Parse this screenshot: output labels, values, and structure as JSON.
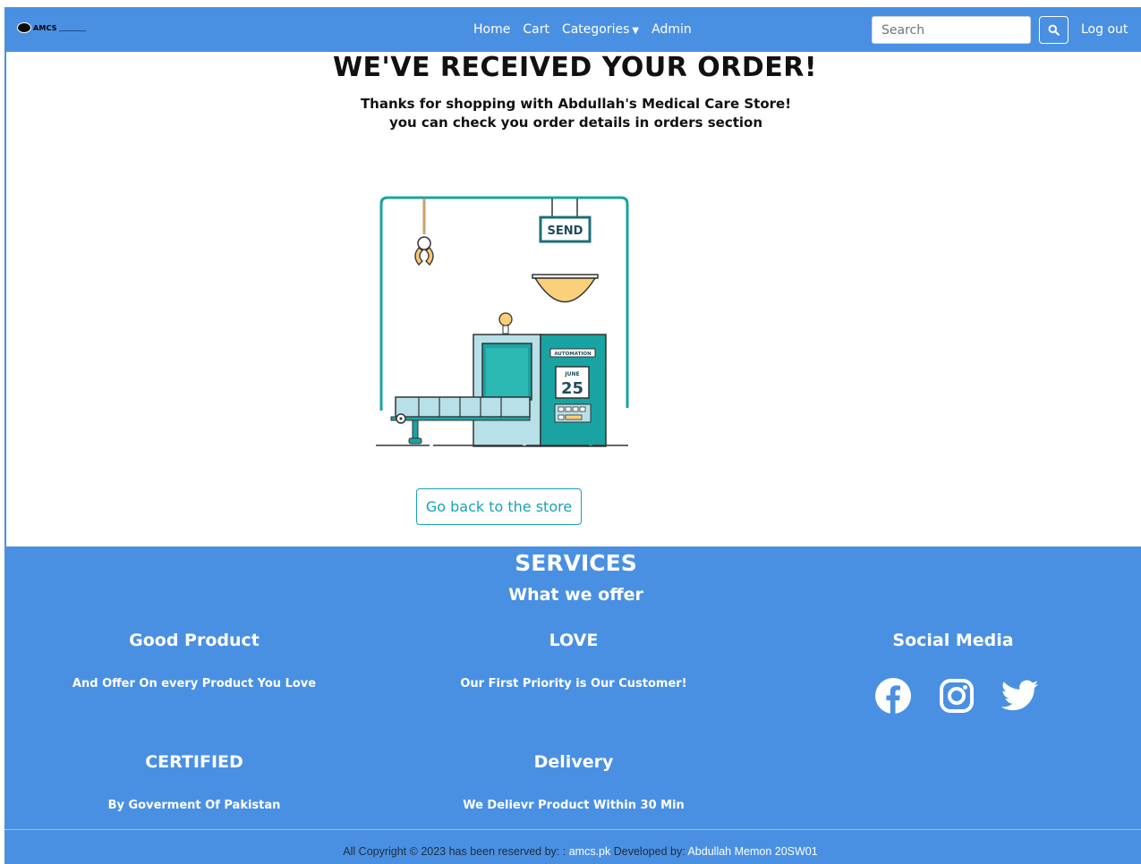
{
  "navbar": {
    "brand_text": "AMCS",
    "links": [
      "Home",
      "Cart",
      "Categories",
      "Admin"
    ],
    "search_placeholder": "Search",
    "logout_label": "Log out"
  },
  "main": {
    "title": "WE'VE RECEIVED YOUR ORDER!",
    "thanks_line1": "Thanks for shopping with Abdullah's Medical Care Store!",
    "thanks_line2": "you can check you order details in orders section",
    "illustration": {
      "sign_label": "SEND",
      "panel_label": "AUTOMATION",
      "month": "JUNE",
      "day": "25"
    },
    "back_button_label": "Go back to the store"
  },
  "footer": {
    "title": "SERVICES",
    "subtitle": "What we offer",
    "services": [
      {
        "heading": "Good Product",
        "text": "And Offer On every Product You Love"
      },
      {
        "heading": "LOVE",
        "text": "Our First Priority is Our Customer!"
      },
      {
        "heading": "CERTIFIED",
        "text": "By Goverment Of Pakistan"
      },
      {
        "heading": "Delivery",
        "text": "We Delievr Product Within 30 Min"
      }
    ],
    "social_heading": "Social Media",
    "social_icons": [
      "facebook-icon",
      "instagram-icon",
      "twitter-icon"
    ],
    "copyright_prefix": "All Copyright © 2023 has been reserved by: :",
    "copyright_site": "amcs.pk",
    "copyright_dev_prefix": "Developed by:",
    "copyright_dev": "Abdullah Memon 20SW01"
  },
  "colors": {
    "primary": "#4a90e2",
    "accent_teal": "#17a2b8",
    "illustration_teal": "#1aa3a3"
  }
}
